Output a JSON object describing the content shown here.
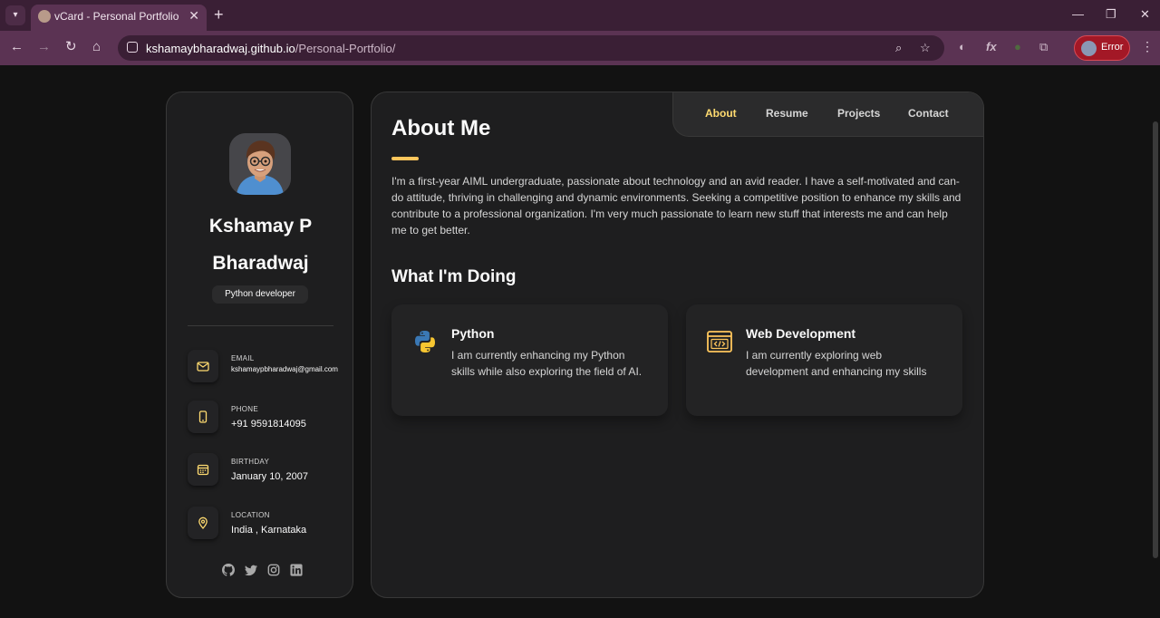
{
  "browser": {
    "tab_title": "vCard - Personal Portfolio",
    "url_host": "kshamaybharadwaj.github.io",
    "url_path": "/Personal-Portfolio/",
    "profile_label": "Error"
  },
  "sidebar": {
    "name": "Kshamay P Bharadwaj",
    "role": "Python developer",
    "contacts": [
      {
        "title": "Email",
        "value": "kshamaypbharadwaj@gmail.com",
        "icon": "mail-icon"
      },
      {
        "title": "Phone",
        "value": "+91 9591814095",
        "icon": "phone-icon"
      },
      {
        "title": "Birthday",
        "value": "January 10, 2007",
        "icon": "calendar-icon"
      },
      {
        "title": "Location",
        "value": "India , Karnataka",
        "icon": "location-icon"
      }
    ],
    "social": [
      "github-icon",
      "twitter-icon",
      "instagram-icon",
      "linkedin-icon"
    ]
  },
  "navbar": {
    "items": [
      "About",
      "Resume",
      "Projects",
      "Contact"
    ],
    "active": "About"
  },
  "about": {
    "title": "About Me",
    "text": "I'm a first-year AIML undergraduate, passionate about technology and an avid reader. I have a self-motivated and can-do attitude, thriving in challenging and dynamic environments. Seeking a competitive position to enhance my skills and contribute to a professional organization. I'm very much passionate to learn new stuff that interests me and can help me to get better.",
    "doing_title": "What I'm Doing",
    "services": [
      {
        "title": "Python",
        "text": "I am currently enhancing my Python skills while also exploring the field of AI.",
        "icon": "python-icon"
      },
      {
        "title": "Web Development",
        "text": "I am currently exploring web development and enhancing my skills",
        "icon": "code-window-icon"
      }
    ]
  },
  "colors": {
    "accent": "#ffdb70",
    "card": "#1e1e1f",
    "background": "#121212",
    "browser_frame": "#5b3353"
  }
}
